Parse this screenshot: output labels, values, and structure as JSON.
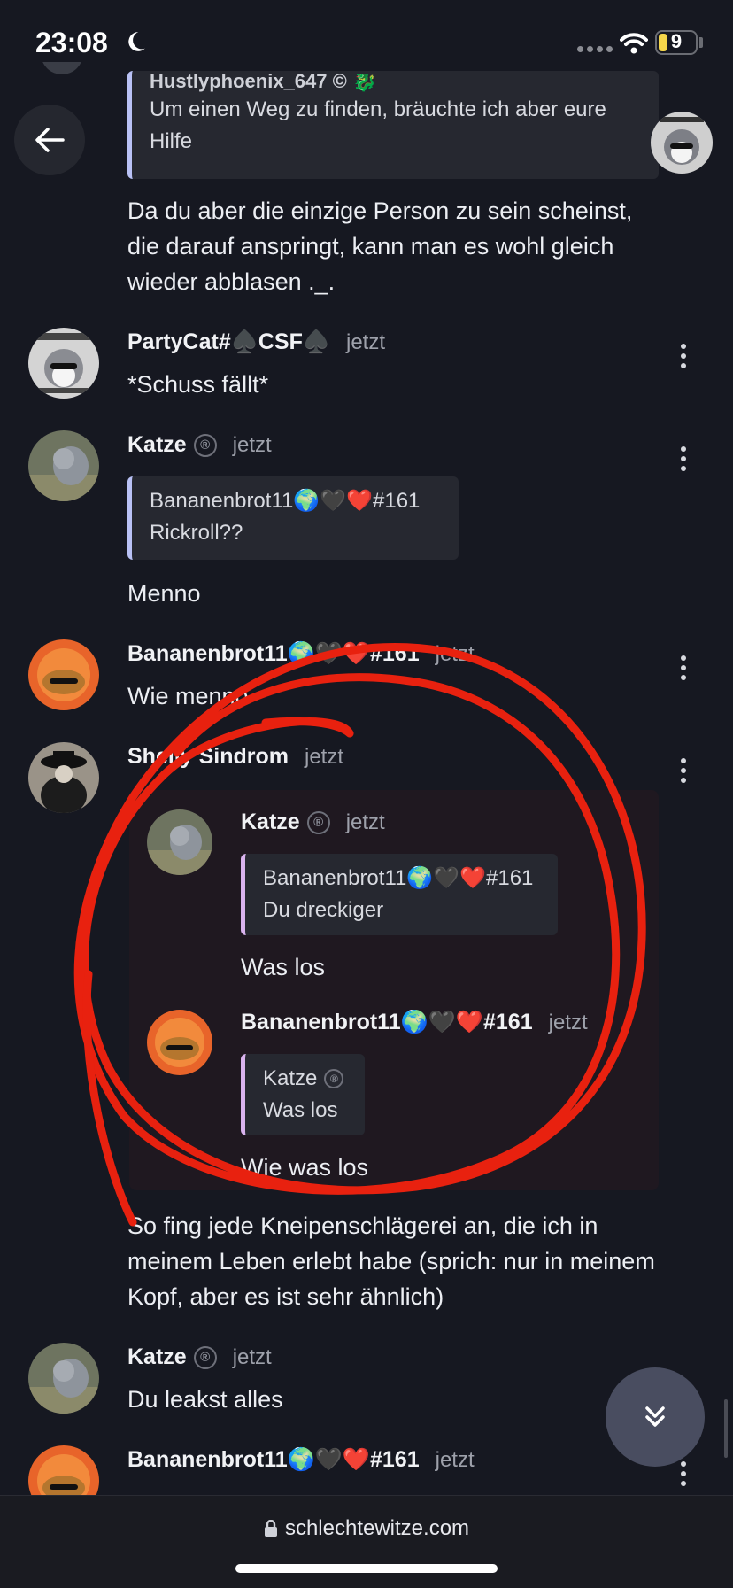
{
  "status_bar": {
    "time": "23:08",
    "battery": "9"
  },
  "top": {
    "partial_name": "Hustlyphoenix_647 © 🐉",
    "quote_text": "Um einen Weg zu finden, bräuchte ich aber eure Hilfe",
    "message": "Da du aber die einzige Person zu sein scheinst, die darauf anspringt, kann man es wohl gleich wieder abblasen ._."
  },
  "messages": [
    {
      "name": "PartyCat#♠️CSF♠️",
      "time": "jetzt",
      "text": "*Schuss fällt*"
    },
    {
      "name": "Katze",
      "badge": "®",
      "time": "jetzt",
      "quote_author": "Bananenbrot11🌍🖤❤️#161",
      "quote_text": "Rickroll??",
      "text": "Menno"
    },
    {
      "name": "Bananenbrot11🌍🖤❤️#161",
      "time": "jetzt",
      "text": "Wie menno"
    },
    {
      "name": "Shelly Sindrom",
      "time": "jetzt",
      "embed": [
        {
          "name": "Katze",
          "badge": "®",
          "time": "jetzt",
          "quote_author": "Bananenbrot11🌍🖤❤️#161",
          "quote_text": "Du dreckiger",
          "text": "Was los"
        },
        {
          "name": "Bananenbrot11🌍🖤❤️#161",
          "time": "jetzt",
          "quote_author": "Katze",
          "quote_text": "Was los",
          "text": "Wie was los"
        }
      ],
      "text": "So fing jede Kneipenschlägerei an, die ich in meinem Leben erlebt habe (sprich: nur in meinem Kopf, aber es ist sehr ähnlich)"
    },
    {
      "name": "Katze",
      "badge": "®",
      "time": "jetzt",
      "text": "Du leakst alles"
    },
    {
      "name": "Bananenbrot11🌍🖤❤️#161",
      "time": "jetzt"
    }
  ],
  "browser": {
    "url": "schlechtewitze.com"
  },
  "colors": {
    "background": "#161821",
    "accent_quote": "#b9c1f5",
    "annotation": "#e8210f"
  }
}
